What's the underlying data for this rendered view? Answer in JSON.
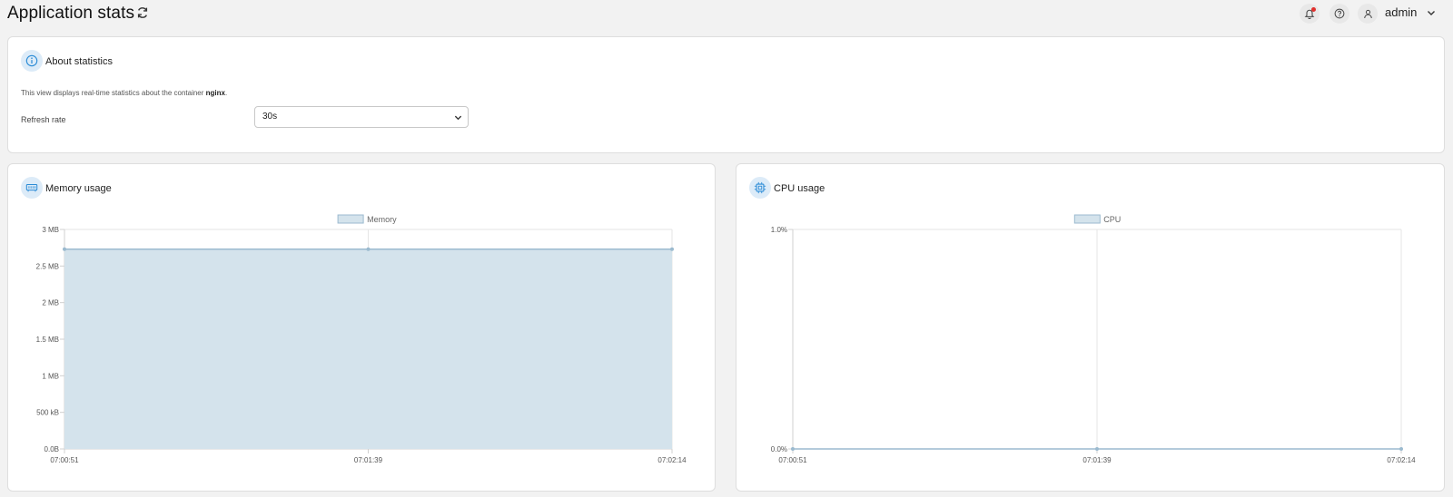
{
  "header": {
    "title": "Application stats",
    "user": "admin"
  },
  "about": {
    "title": "About statistics",
    "description_prefix": "This view displays real-time statistics about the container ",
    "container_name": "nginx",
    "description_suffix": ".",
    "refresh_label": "Refresh rate",
    "refresh_value": "30s"
  },
  "memory": {
    "title": "Memory usage"
  },
  "cpu": {
    "title": "CPU usage"
  },
  "colors": {
    "fill": "#d4e3ec",
    "line": "#9bbacf",
    "accent": "#2a8bd6",
    "notification": "#e0302d"
  },
  "chart_data": [
    {
      "type": "area",
      "legend": "Memory",
      "x": [
        "07:00:51",
        "07:01:39",
        "07:02:14"
      ],
      "values_mb": [
        2.73,
        2.73,
        2.73
      ],
      "yticks": [
        "0.0B",
        "500 kB",
        "1 MB",
        "1.5 MB",
        "2 MB",
        "2.5 MB",
        "3 MB"
      ],
      "ylim": [
        0,
        3
      ],
      "grid": true,
      "legend_position": "top"
    },
    {
      "type": "area",
      "legend": "CPU",
      "x": [
        "07:00:51",
        "07:01:39",
        "07:02:14"
      ],
      "values": [
        0,
        0,
        0
      ],
      "yticks": [
        "0.0%",
        "1.0%"
      ],
      "ylim": [
        0,
        1
      ],
      "grid": true,
      "legend_position": "top"
    }
  ]
}
